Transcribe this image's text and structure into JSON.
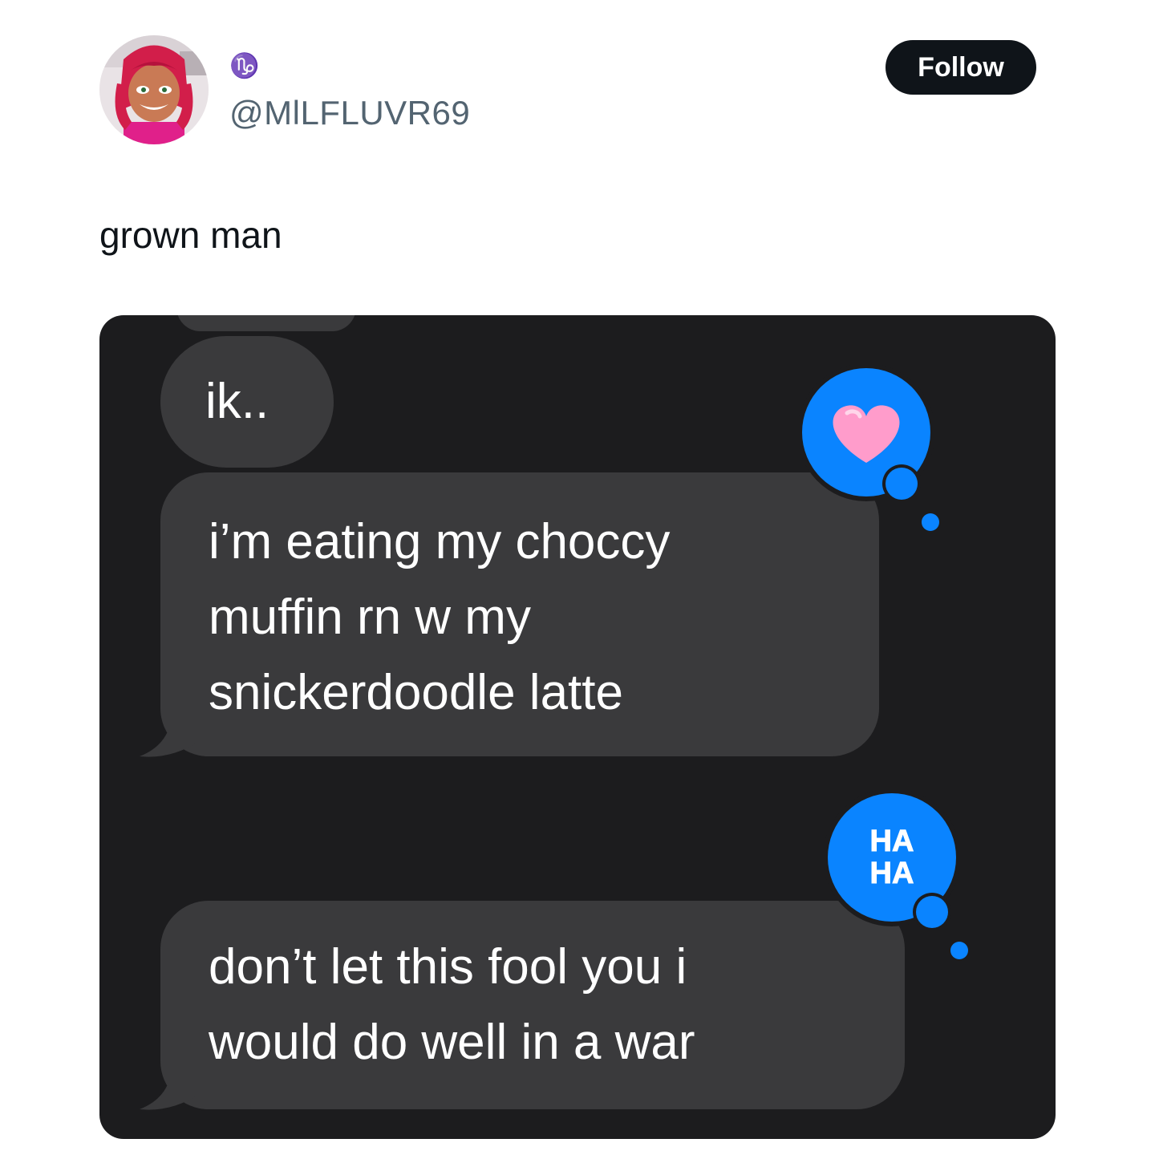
{
  "tweet": {
    "display_name": "♑",
    "handle": "@MlLFLUVR69",
    "follow_label": "Follow",
    "text": "grown man"
  },
  "conversation": {
    "messages": [
      {
        "text": "ik.."
      },
      {
        "lines": [
          "i’m eating my choccy",
          "muffin rn w my",
          "snickerdoodle latte"
        ],
        "reaction": "heart-icon"
      },
      {
        "lines": [
          "don’t let this fool you i",
          "would do well in a war"
        ],
        "reaction": "haha-icon"
      }
    ],
    "haha_text": [
      "HA",
      "HA"
    ]
  },
  "colors": {
    "follow_bg": "#0f1419",
    "bubble_bg": "#3a3a3c",
    "chat_bg": "#1c1c1e",
    "reaction_blue": "#0a84ff",
    "heart_pink": "#ff9ccb"
  }
}
